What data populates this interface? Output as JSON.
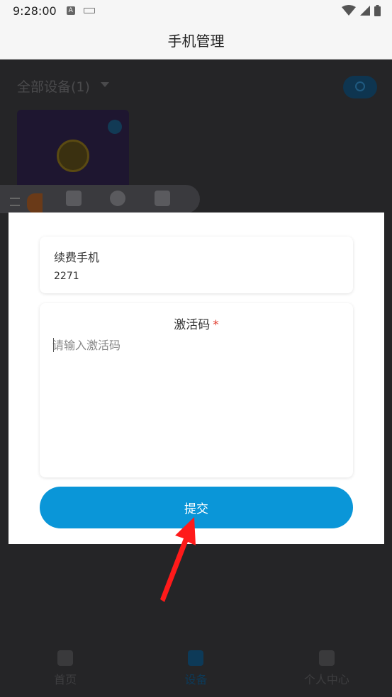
{
  "status_bar": {
    "time": "9:28:00",
    "a_icon": "A"
  },
  "header": {
    "title": "手机管理"
  },
  "background": {
    "filter_label": "全部设备(1)",
    "bottom_nav": [
      {
        "label": "首页",
        "icon": "home-icon"
      },
      {
        "label": "设备",
        "icon": "phone-icon",
        "active": true
      },
      {
        "label": "个人中心",
        "icon": "user-icon"
      }
    ]
  },
  "modal": {
    "renew_label": "续费手机",
    "renew_value": "2271",
    "code_label": "激活码",
    "required_mark": "*",
    "code_placeholder": "请输入激活码",
    "code_value": "",
    "submit_label": "提交"
  },
  "colors": {
    "accent": "#0a96d8",
    "required": "#e03b2c",
    "annotation_arrow": "#ff1a1a"
  }
}
